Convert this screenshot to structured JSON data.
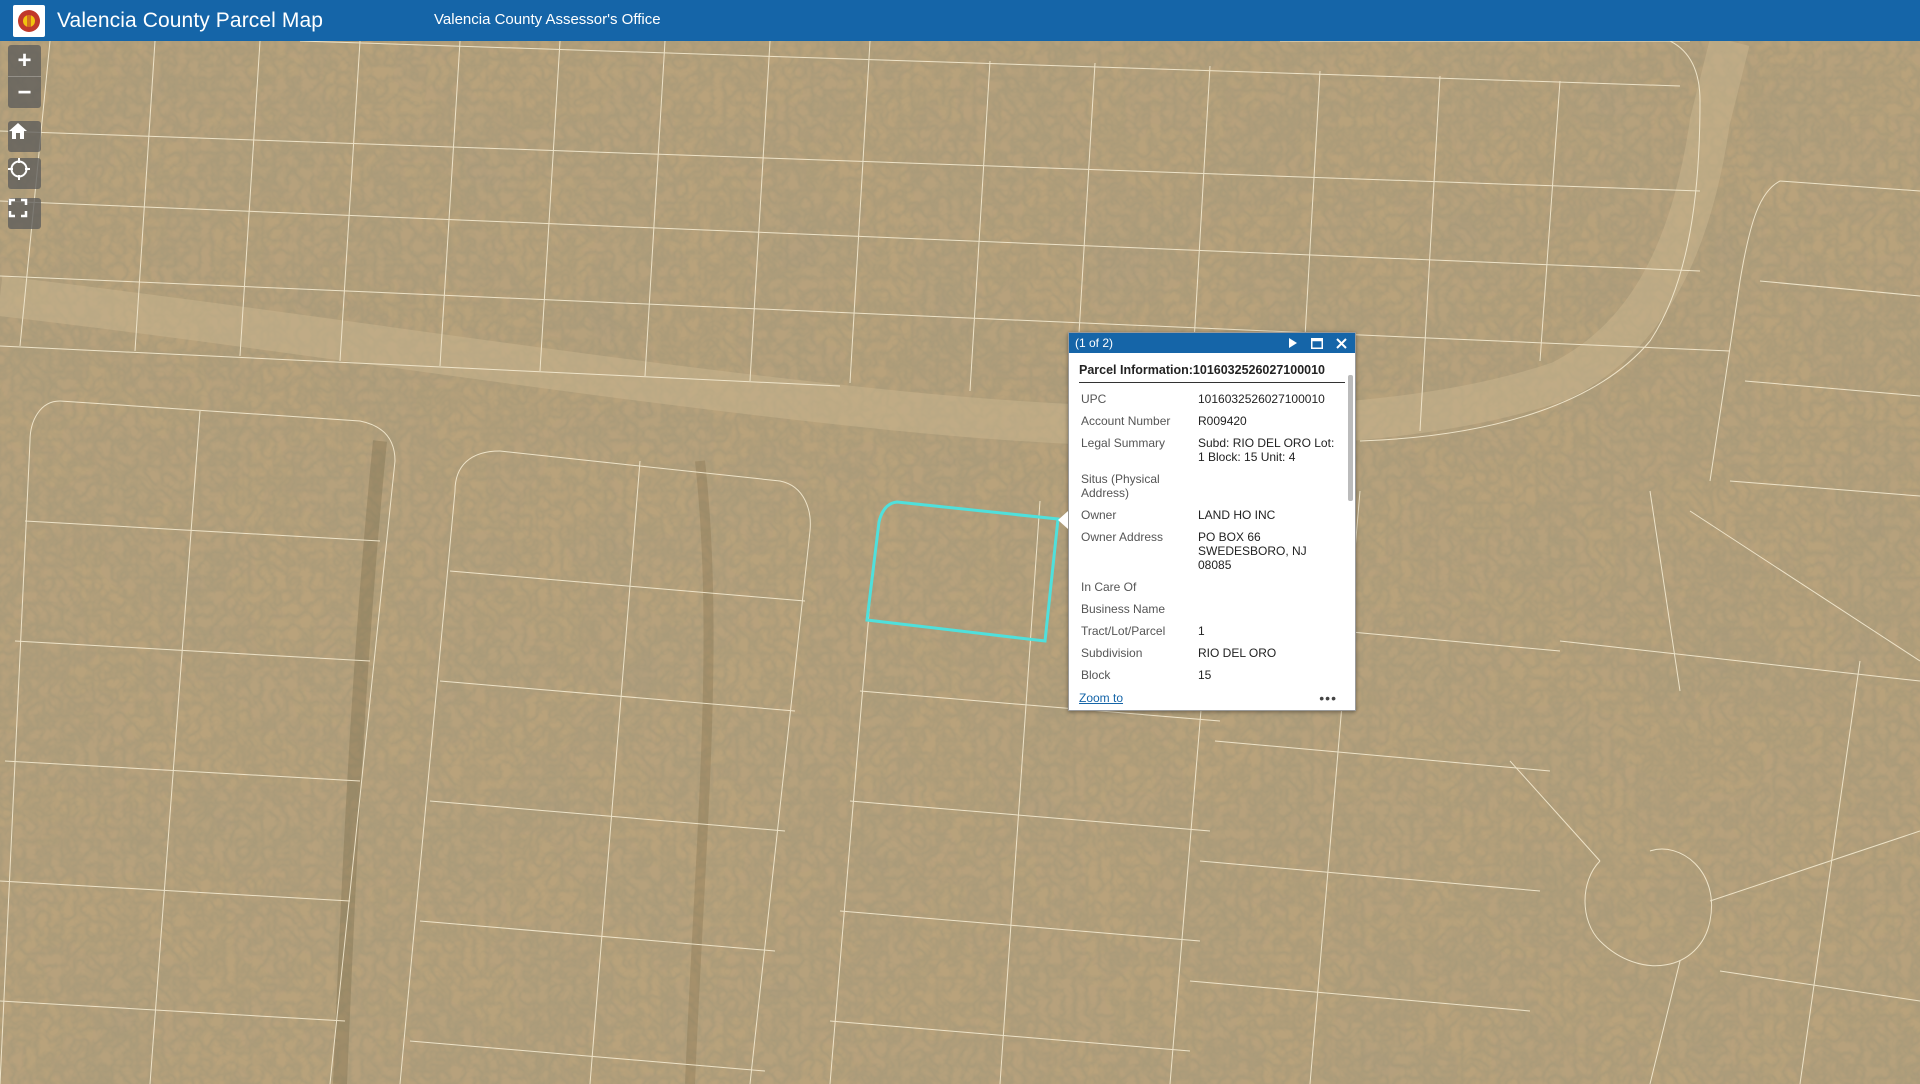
{
  "header": {
    "title": "Valencia County Parcel Map",
    "subtitle": "Valencia County Assessor's Office"
  },
  "controls": {
    "zoom_in": "+",
    "zoom_out": "−"
  },
  "popup": {
    "pager": "(1 of 2)",
    "title": "Parcel Information:1016032526027100010",
    "fields": [
      {
        "label": "UPC",
        "value": "1016032526027100010"
      },
      {
        "label": "Account Number",
        "value": "R009420"
      },
      {
        "label": "Legal Summary",
        "value": "Subd: RIO DEL ORO Lot: 1 Block: 15 Unit: 4"
      },
      {
        "label": "Situs (Physical Address)",
        "value": ""
      },
      {
        "label": "Owner",
        "value": "LAND HO INC"
      },
      {
        "label": "Owner Address",
        "value": "PO BOX 66 SWEDESBORO, NJ 08085"
      },
      {
        "label": "In Care Of",
        "value": ""
      },
      {
        "label": "Business Name",
        "value": ""
      },
      {
        "label": "Tract/Lot/Parcel",
        "value": "1"
      },
      {
        "label": "Subdivision",
        "value": "RIO DEL ORO"
      },
      {
        "label": "Block",
        "value": "15"
      }
    ],
    "zoom_to": "Zoom to",
    "more": "•••"
  },
  "colors": {
    "header_bg": "#1565a8",
    "parcel_line": "#f4ead0",
    "selected_parcel": "#4fe0dc",
    "terrain": "#b7a07a"
  }
}
